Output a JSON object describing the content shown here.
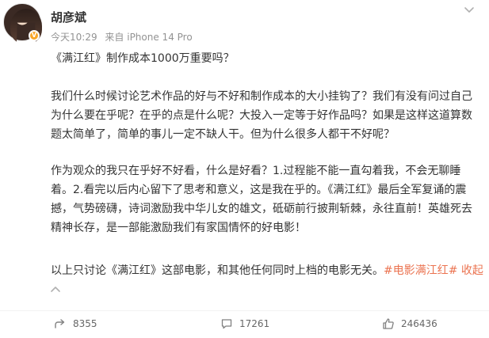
{
  "post": {
    "author": "胡彦斌",
    "timestamp": "今天10:29",
    "source": "来自 iPhone 14 Pro",
    "title_line": "《满江红》制作成本1000万重要吗？",
    "p2_lines": [
      "我们什么时候讨论艺术作品的好与不好和制作成本的大小挂钩了？我们有没有问过自己",
      "为什么要在乎呢？在乎的点是什么呢？大投入一定等于好作品吗？如果是这样这道算数",
      "题太简单了，简单的事儿一定不缺人干。但为什么很多人都干不好呢？"
    ],
    "p3_lines": [
      "作为观众的我只在乎好不好看，什么是好看？1.过程能不能一直勾着我，不会无聊睡",
      "着。2.看完以后内心留下了思考和意义，这是我在乎的。《满江红》最后全军复诵的震",
      "撼，气势磅礴，诗词激励我中华儿女的雄文，砥砺前行披荆斩棘，永往直前！英雄死去",
      "精神长存，是一部能激励我们有家国情怀的好电影！"
    ],
    "p4_text": "以上只讨论《满江红》这部电影，和其他任何同时上档的电影无关。",
    "hashtag": "#电影满江红#",
    "collapse_label": "收起"
  },
  "actions": {
    "share_count": "8355",
    "comment_count": "17261",
    "like_count": "246436"
  },
  "icons": {
    "more": "chevron-down-icon",
    "collapse": "chevron-up-icon",
    "share": "share-icon",
    "comment": "comment-icon",
    "like": "thumbs-up-icon"
  },
  "colors": {
    "link": "#eb7350",
    "meta": "#939393",
    "text": "#333333",
    "badge": "#f9a628"
  }
}
